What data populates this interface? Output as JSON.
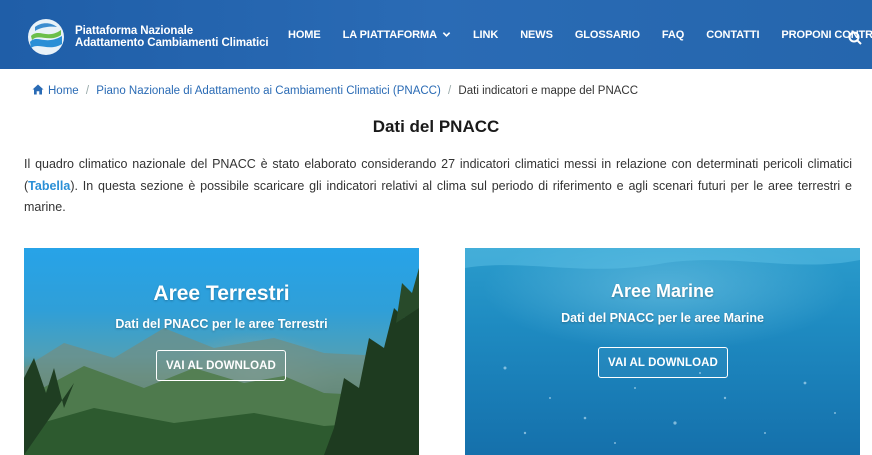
{
  "header": {
    "brand_line1": "Piattaforma Nazionale",
    "brand_line2": "Adattamento Cambiamenti Climatici",
    "nav": [
      {
        "label": "HOME"
      },
      {
        "label": "LA PIATTAFORMA"
      },
      {
        "label": "LINK"
      },
      {
        "label": "NEWS"
      },
      {
        "label": "GLOSSARIO"
      },
      {
        "label": "FAQ"
      },
      {
        "label": "CONTATTI"
      },
      {
        "label": "PROPONI CONTRIBUTO"
      }
    ],
    "bg_color": "#2566ad"
  },
  "breadcrumb": {
    "home": "Home",
    "level1": "Piano Nazionale di Adattamento ai Cambiamenti Climatici (PNACC)",
    "current": "Dati indicatori e mappe del PNACC",
    "separator": "/"
  },
  "page": {
    "title": "Dati del PNACC",
    "intro_part1": "Il quadro climatico nazionale del PNACC è stato elaborato considerando 27 indicatori climatici messi in relazione con determinati pericoli climatici (",
    "intro_link": "Tabella",
    "intro_part2": "). In questa sezione è possibile scaricare gli indicatori relativi al clima sul periodo di riferimento e agli scenari futuri per le aree terrestri e marine."
  },
  "cards": [
    {
      "title": "Aree Terrestri",
      "subtitle": "Dati del PNACC per le aree Terrestri",
      "button": "VAI AL DOWNLOAD"
    },
    {
      "title": "Aree Marine",
      "subtitle": "Dati del PNACC per le aree Marine",
      "button": "VAI AL DOWNLOAD"
    }
  ],
  "colors": {
    "link": "#2a8fd6",
    "header": "#2566ad"
  }
}
